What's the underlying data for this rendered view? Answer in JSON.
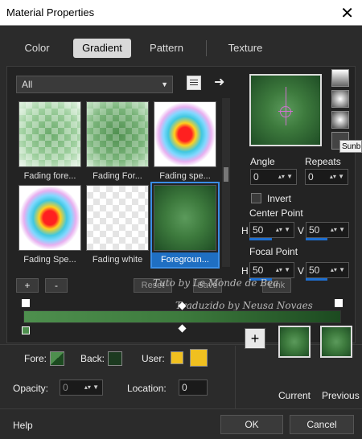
{
  "window": {
    "title": "Material Properties",
    "close": "✕"
  },
  "tabs": [
    {
      "label": "Color",
      "active": false
    },
    {
      "label": "Gradient",
      "active": true
    },
    {
      "label": "Pattern",
      "active": false
    },
    {
      "label": "Texture",
      "active": false
    }
  ],
  "category_dropdown": {
    "value": "All"
  },
  "thumbnails": [
    {
      "label": "Fading fore...",
      "selected": false
    },
    {
      "label": "Fading For...",
      "selected": false
    },
    {
      "label": "Fading spe...",
      "selected": false
    },
    {
      "label": "Fading Spe...",
      "selected": false
    },
    {
      "label": "Fading white",
      "selected": false
    },
    {
      "label": "Foregroun...",
      "selected": true
    }
  ],
  "list_buttons": {
    "add": "+",
    "remove": "-",
    "reset": "Reset",
    "save": "Save",
    "link": "Link"
  },
  "angle": {
    "label": "Angle",
    "value": "0"
  },
  "repeats": {
    "label": "Repeats",
    "value": "0"
  },
  "invert": {
    "label": "Invert",
    "checked": false
  },
  "center_point": {
    "label": "Center Point",
    "h_label": "H",
    "h_value": "50",
    "v_label": "V",
    "v_value": "50"
  },
  "focal_point": {
    "label": "Focal Point",
    "h_label": "H",
    "h_value": "50",
    "v_label": "V",
    "v_value": "50"
  },
  "tooltip": "Sunb",
  "fore_label": "Fore:",
  "back_label": "Back:",
  "user_label": "User:",
  "opacity": {
    "label": "Opacity:",
    "value": "0"
  },
  "location": {
    "label": "Location:",
    "value": "0"
  },
  "add_swatch_button": "+",
  "current_label": "Current",
  "previous_label": "Previous",
  "help": "Help",
  "ok": "OK",
  "cancel": "Cancel",
  "watermark": {
    "line1": "Tuto by Le Monde de Bea",
    "line2": "Traduzido by Neusa Novaes"
  },
  "colors": {
    "foreground": "#4e8f4e",
    "background": "#1c4a20",
    "user": "#f0c020",
    "accent": "#1e6fd0"
  }
}
